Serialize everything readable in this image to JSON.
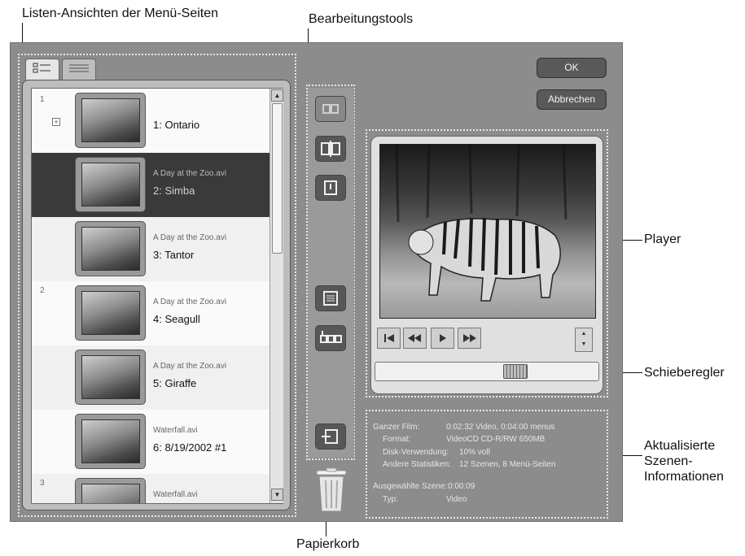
{
  "callouts": {
    "list_views": "Listen-Ansichten der Menü-Seiten",
    "edit_tools": "Bearbeitungstools",
    "player": "Player",
    "slider": "Schieberegler",
    "info": [
      "Aktualisierte",
      "Szenen-",
      "Informationen"
    ],
    "trash": "Papierkorb"
  },
  "buttons": {
    "ok": "OK",
    "cancel": "Abbrechen"
  },
  "scene_list": {
    "page_numbers": [
      "1",
      "2",
      "3"
    ],
    "rows": [
      {
        "source": "",
        "title": "1:   Ontario"
      },
      {
        "source": "A Day at the Zoo.avi",
        "title": "2:   Simba"
      },
      {
        "source": "A Day at the Zoo.avi",
        "title": "3:   Tantor"
      },
      {
        "source": "A Day at the Zoo.avi",
        "title": "4:   Seagull"
      },
      {
        "source": "A Day at the Zoo.avi",
        "title": "5:   Giraffe"
      },
      {
        "source": "Waterfall.avi",
        "title": "6:   8/19/2002 #1"
      },
      {
        "source": "Waterfall.avi",
        "title": ""
      }
    ],
    "selected_index": 1
  },
  "player": {
    "slider_position": 0.65
  },
  "info": {
    "total_film_label": "Ganzer Film:",
    "total_film_value": "0:02:32 Video, 0:04:00 menus",
    "format_label": "Format:",
    "format_value": "VideoCD  CD-R/RW 650MB",
    "disk_label": "Disk-Verwendung:",
    "disk_value": "10% voll",
    "stats_label": "Andere Statistiken:",
    "stats_value": "12 Szenen, 8 Menü-Seiten",
    "selected_label": "Ausgewählte Szene:",
    "selected_value": "0:00:09",
    "type_label": "Typ:",
    "type_value": "Video"
  },
  "colors": {
    "panel": "#8c8c8c",
    "selected_row": "#3a3a3a",
    "button": "#595959",
    "dotted_border": "#e8e8e8"
  },
  "icons": {
    "tool_1": "merge-scenes-icon",
    "tool_2": "split-scenes-icon",
    "tool_3": "set-thumbnail-icon",
    "tool_4": "menu-properties-icon",
    "tool_5": "numbering-icon",
    "tool_6": "page-link-icon",
    "trash": "trash-icon"
  }
}
